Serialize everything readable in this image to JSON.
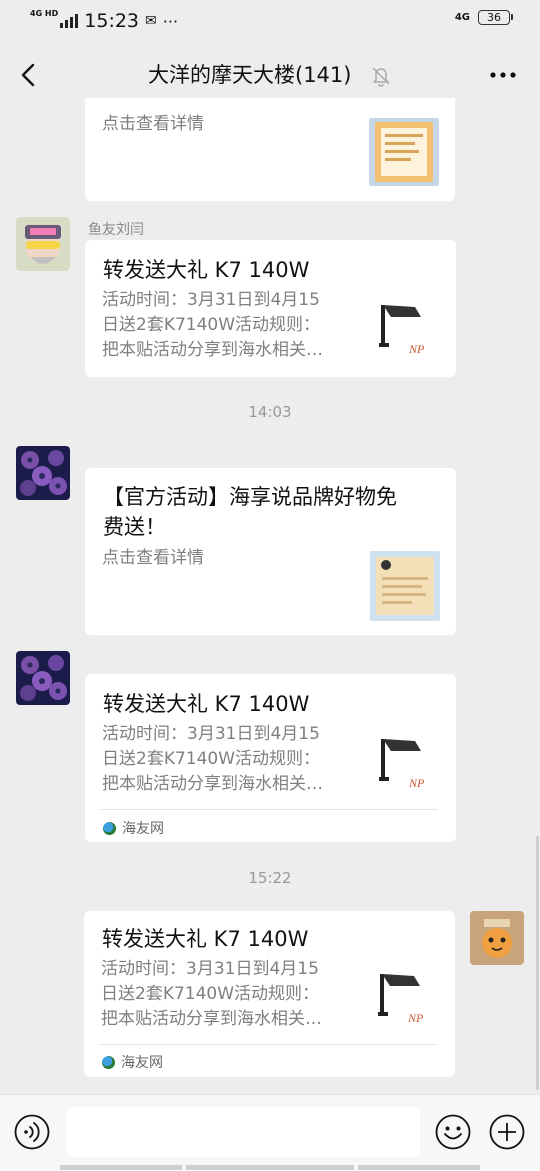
{
  "status": {
    "network": "4G HD",
    "time": "15:23",
    "network_right": "4G",
    "battery": "36"
  },
  "header": {
    "title": "大洋的摩天大楼(141)"
  },
  "messages": [
    {
      "desc": "点击查看详情"
    },
    {
      "sender": "鱼友刘闫",
      "title": "转发送大礼 K7 140W",
      "desc_lines": [
        "活动时间：3月31日到4月15",
        "日送2套K7140W活动规则：",
        "把本贴活动分享到海水相关…"
      ]
    },
    {
      "time": "14:03"
    },
    {
      "title_lines": [
        "【官方活动】海享说品牌好物免",
        "费送！"
      ],
      "desc": "点击查看详情"
    },
    {
      "title": "转发送大礼 K7 140W",
      "desc_lines": [
        "活动时间：3月31日到4月15",
        "日送2套K7140W活动规则：",
        "把本贴活动分享到海水相关…"
      ],
      "source": "海友网"
    },
    {
      "time": "15:22"
    },
    {
      "title": "转发送大礼 K7 140W",
      "desc_lines": [
        "活动时间：3月31日到4月15",
        "日送2套K7140W活动规则：",
        "把本贴活动分享到海水相关…"
      ],
      "source": "海友网"
    }
  ],
  "colors": {
    "background": "#ededed",
    "card": "#ffffff",
    "muted_text": "#7f7f7f"
  },
  "icons": [
    "back-arrow-icon",
    "mute-bell-icon",
    "more-dots-icon",
    "voice-icon",
    "emoji-icon",
    "plus-icon",
    "link-source-icon"
  ]
}
